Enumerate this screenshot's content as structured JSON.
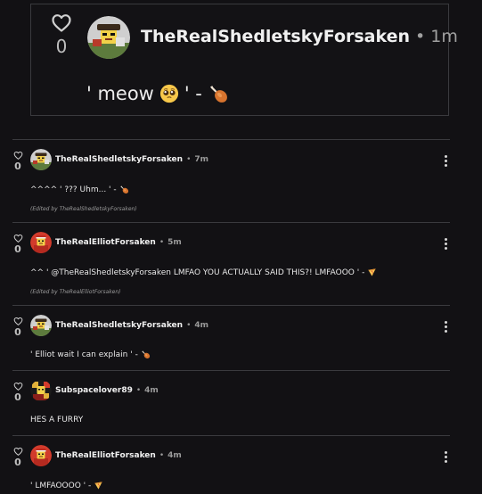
{
  "quoted_post": {
    "like_count": "0",
    "author": "TheRealShedletskyForsaken",
    "separator": "•",
    "time": "1m",
    "text_prefix": "' meow",
    "text_mid": "' -"
  },
  "comments": [
    {
      "like_count": "0",
      "author": "TheRealShedletskyForsaken",
      "separator": "•",
      "time": "7m",
      "text": "^^^^ ' ??? Uhm... ' -",
      "emoji": "drumstick",
      "edited": "(Edited by TheRealShedletskyForsaken)"
    },
    {
      "like_count": "0",
      "author": "TheRealElliotForsaken",
      "separator": "•",
      "time": "5m",
      "text": "^^ ' @TheRealShedletskyForsaken LMFAO YOU ACTUALLY SAID THIS?! LMFAOOO ' -",
      "emoji": "pizza",
      "edited": "(Edited by TheRealElliotForsaken)"
    },
    {
      "like_count": "0",
      "author": "TheRealShedletskyForsaken",
      "separator": "•",
      "time": "4m",
      "text": "' Elliot wait I can explain ' -",
      "emoji": "drumstick"
    },
    {
      "like_count": "0",
      "author": "Subspacelover89",
      "separator": "•",
      "time": "4m",
      "text": "HES A FURRY"
    },
    {
      "like_count": "0",
      "author": "TheRealElliotForsaken",
      "separator": "•",
      "time": "4m",
      "text": "' LMFAOOOO ' -",
      "emoji": "pizza"
    }
  ]
}
